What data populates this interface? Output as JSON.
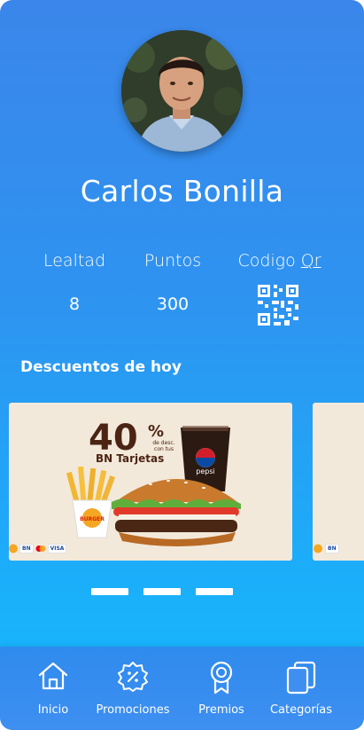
{
  "profile": {
    "name": "Carlos Bonilla",
    "avatar_icon": "user-photo"
  },
  "stats": {
    "lealtad_label": "Lealtad",
    "lealtad_value": "8",
    "puntos_label": "Puntos",
    "puntos_value": "300",
    "qr_label": "Codigo",
    "qr_link": "Qr",
    "qr_icon": "qr-code-icon"
  },
  "section": {
    "title": "Descuentos de hoy"
  },
  "promo": {
    "headline": "40",
    "pct": "%",
    "small": "de desc. con tus",
    "sub": "BN Tarjetas",
    "brand": "BURGER KING",
    "drink": "pepsi",
    "pay_chips": [
      "BN",
      "VISA"
    ]
  },
  "pager": {
    "count": 3
  },
  "nav": {
    "items": [
      {
        "label": "Inicio",
        "icon": "home-icon"
      },
      {
        "label": "Promociones",
        "icon": "discount-badge-icon"
      },
      {
        "label": "Premios",
        "icon": "award-ribbon-icon"
      },
      {
        "label": "Categorías",
        "icon": "stacked-cards-icon"
      }
    ]
  },
  "colors": {
    "gradient_top": "#3b86ea",
    "gradient_bottom": "#14b8fd",
    "card_bg": "#f3e9da",
    "promo_brown": "#4b2414"
  }
}
